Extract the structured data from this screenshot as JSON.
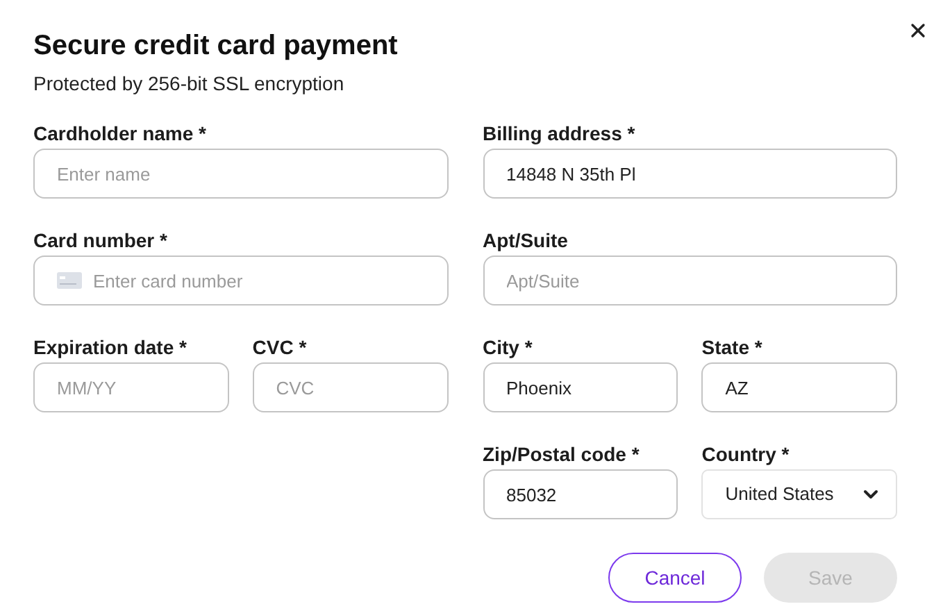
{
  "title": "Secure credit card payment",
  "subtitle": "Protected by 256-bit SSL encryption",
  "left_rows": [
    [
      {
        "label": "Cardholder name *",
        "kind": "text",
        "placeholder": "Enter name"
      }
    ],
    [
      {
        "label": "Card number *",
        "kind": "card",
        "placeholder": "Enter card number"
      }
    ],
    [
      {
        "label": "Expiration date *",
        "kind": "text",
        "placeholder": "MM/YY"
      },
      {
        "label": "CVC *",
        "kind": "text",
        "placeholder": "CVC"
      }
    ]
  ],
  "right_rows": [
    [
      {
        "label": "Billing address *",
        "kind": "text",
        "value": "14848 N 35th Pl"
      }
    ],
    [
      {
        "label": "Apt/Suite",
        "kind": "text",
        "placeholder": "Apt/Suite"
      }
    ],
    [
      {
        "label": "City *",
        "kind": "text",
        "value": "Phoenix"
      },
      {
        "label": "State *",
        "kind": "text",
        "value": "AZ"
      }
    ],
    [
      {
        "label": "Zip/Postal code *",
        "kind": "text",
        "value": "85032"
      },
      {
        "label": "Country *",
        "kind": "select",
        "value": "United States"
      }
    ]
  ],
  "buttons": [
    {
      "label": "Cancel",
      "kind": "secondary",
      "disabled": false
    },
    {
      "label": "Save",
      "kind": "primary",
      "disabled": true
    }
  ]
}
